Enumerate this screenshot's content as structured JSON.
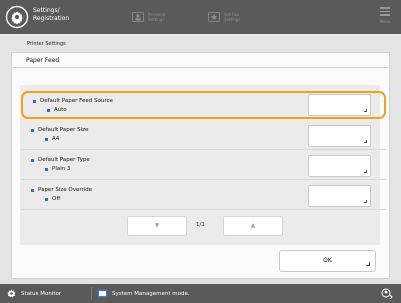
{
  "header": {
    "title_line1": "Settings/",
    "title_line2": "Registration",
    "tab1": {
      "line1": "Personal",
      "line2": "Settings"
    },
    "tab2": {
      "line1": "Set Fav.",
      "line2": "Settings"
    },
    "menu_label": "Menu"
  },
  "breadcrumb": "Printer Settings",
  "panel_title": "Paper Feed",
  "settings": [
    {
      "label": "Default Paper Feed Source",
      "value": "Auto",
      "selected": true
    },
    {
      "label": "Default Paper Size",
      "value": "A4"
    },
    {
      "label": "Default Paper Type",
      "value": "Plain 3"
    },
    {
      "label": "Paper Size Override",
      "value": "Off"
    }
  ],
  "pager": {
    "down": "▼",
    "up": "▲",
    "page": "1/1"
  },
  "ok_label": "OK",
  "status_bar": {
    "status_monitor": "Status Monitor",
    "system_mode": "System Management mode."
  },
  "colors": {
    "selection": "#f0a21e",
    "bullet": "#2b6cc4",
    "bar": "#5a5a5a"
  }
}
